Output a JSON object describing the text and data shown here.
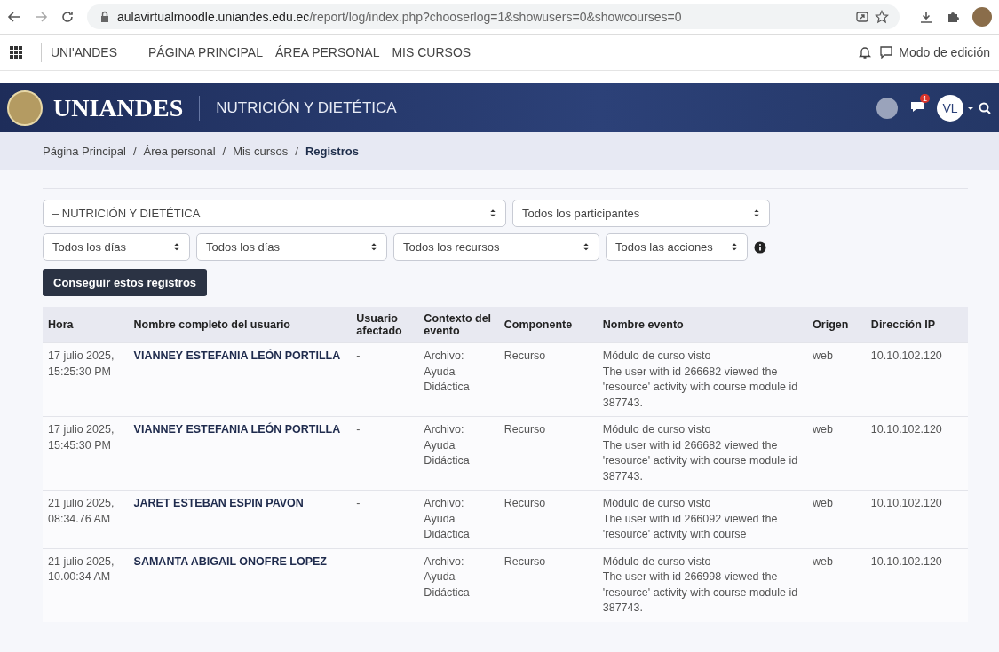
{
  "browser": {
    "url_host": "aulavirtualmoodle.uniandes.edu.ec",
    "url_path": "/report/log/index.php?chooserlog=1&showusers=0&showcourses=0"
  },
  "top_nav": {
    "brand": "UNI'ANDES",
    "links": [
      "PÁGINA PRINCIPAL",
      "ÁREA PERSONAL",
      "MIS CURSOS"
    ],
    "edit_mode": "Modo de edición"
  },
  "banner": {
    "logo": "UNIANDES",
    "course": "NUTRICIÓN Y DIETÉTICA",
    "notification_count": "1",
    "avatar": "VL"
  },
  "breadcrumb": [
    {
      "label": "Página Principal",
      "current": false
    },
    {
      "separator": "/",
      "label": "Área personal",
      "current": false
    },
    {
      "separator": "/",
      "label": "Mis cursos",
      "current": false
    },
    {
      "separator": "/",
      "label": "Registros",
      "current": true
    }
  ],
  "filters": [
    [
      "– NUTRICIÓN Y DIETÉTICA",
      "Todos los participantes"
    ],
    [
      "Todos los días",
      "Todos los días",
      "Todos los recursos",
      "Todos las acciones"
    ]
  ],
  "submit": "Conseguir estos registros",
  "table": {
    "columns": [
      "Hora",
      "Nombre completo del usuario",
      "Usuario afectado",
      "Contexto del evento",
      "Componente",
      "Nombre evento",
      "Origen",
      "Dirección IP"
    ],
    "rows": [
      {
        "time": [
          "17 julio 2025,",
          "15:25:30 PM"
        ],
        "user": "VIANNEY ESTEFANIA LEÓN PORTILLA",
        "affected": "-",
        "context": "Archivo: Ayuda Didáctica",
        "component": "Recurso",
        "event": "Módulo de curso visto",
        "description": "The user with id  266682 viewed the 'resource' activity with course module id 387743.",
        "origin": "web",
        "ip": "10.10.102.120"
      },
      {
        "time": [
          "17 julio 2025,",
          "15:45:30 PM"
        ],
        "user": "VIANNEY ESTEFANIA LEÓN PORTILLA",
        "affected": "-",
        "context": "Archivo: Ayuda Didáctica",
        "component": "Recurso",
        "event": "Módulo de curso visto",
        "description": "The user with id  266682 viewed the 'resource' activity with course module id 387743.",
        "origin": "web",
        "ip": "10.10.102.120"
      },
      {
        "time": [
          "21 julio 2025,",
          "08:34.76 AM"
        ],
        "user": "JARET ESTEBAN ESPIN PAVON",
        "affected": "-",
        "context": "Archivo: Ayuda Didáctica",
        "component": "Recurso",
        "event": "Módulo de curso visto",
        "description": "The user with id  266092 viewed the 'resource' activity with course",
        "origin": "web",
        "ip": "10.10.102.120"
      },
      {
        "time": [
          "21 julio 2025,",
          "10.00:34 AM"
        ],
        "user": "SAMANTA ABIGAIL ONOFRE LOPEZ",
        "context": "Archivo: Ayuda Didáctica",
        "component": "Recurso",
        "event": "Módulo de curso visto",
        "description": "The user with id  266998 viewed the 'resource' activity with course module id 387743.",
        "origin": "web",
        "ip": "10.10.102.120"
      }
    ]
  }
}
